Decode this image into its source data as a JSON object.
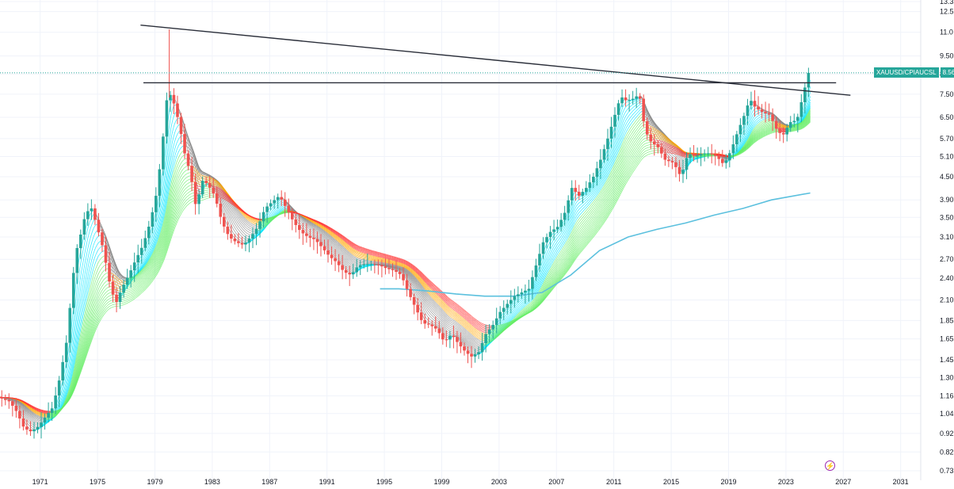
{
  "symbol_label": "XAUUSD/CPIAUCSL",
  "last_value_label": "8.56",
  "alert_icon": "lightning-icon",
  "colors": {
    "up": "#26a69a",
    "down": "#ef5350",
    "long_ma": "#5bc0de",
    "trendline": "#2a2e39",
    "price_line": "#26a69a",
    "ribbon_green": "#66ee66",
    "ribbon_cyan": "#00e5ff",
    "ribbon_red": "#ff3333",
    "ribbon_orange": "#ffa500",
    "ribbon_gray": "#888888"
  },
  "chart_data": {
    "type": "candlestick",
    "title": "",
    "y_scale": "log",
    "ylim": [
      0.73,
      13.3
    ],
    "y_ticks": [
      "13.3",
      "12.5",
      "11.0",
      "9.50",
      "8.50",
      "7.50",
      "6.50",
      "5.70",
      "5.10",
      "4.50",
      "3.90",
      "3.50",
      "3.10",
      "2.70",
      "2.40",
      "2.10",
      "1.85",
      "1.65",
      "1.45",
      "1.30",
      "1.16",
      "1.04",
      "0.92",
      "0.82",
      "0.73"
    ],
    "x_ticks": [
      "1971",
      "1975",
      "1979",
      "1983",
      "1987",
      "1991",
      "1995",
      "1999",
      "2003",
      "2007",
      "2011",
      "2015",
      "2019",
      "2023",
      "2027",
      "2031"
    ],
    "xlim": [
      1968.2,
      2032.4
    ],
    "last_value": 8.56,
    "price_points": [
      [
        1968.2,
        1.15
      ],
      [
        1969.0,
        1.12
      ],
      [
        1969.5,
        1.05
      ],
      [
        1970.0,
        0.95
      ],
      [
        1970.5,
        0.93
      ],
      [
        1971.0,
        0.96
      ],
      [
        1971.5,
        1.02
      ],
      [
        1972.0,
        1.08
      ],
      [
        1972.5,
        1.3
      ],
      [
        1973.0,
        1.65
      ],
      [
        1973.3,
        2.2
      ],
      [
        1973.6,
        2.8
      ],
      [
        1974.0,
        3.2
      ],
      [
        1974.3,
        3.6
      ],
      [
        1974.7,
        3.7
      ],
      [
        1975.0,
        3.4
      ],
      [
        1975.5,
        2.9
      ],
      [
        1976.0,
        2.3
      ],
      [
        1976.4,
        2.05
      ],
      [
        1976.8,
        2.25
      ],
      [
        1977.3,
        2.45
      ],
      [
        1977.8,
        2.7
      ],
      [
        1978.3,
        2.95
      ],
      [
        1978.8,
        3.4
      ],
      [
        1979.2,
        4.0
      ],
      [
        1979.6,
        5.2
      ],
      [
        1979.9,
        7.1
      ],
      [
        1980.1,
        7.6
      ],
      [
        1980.4,
        7.2
      ],
      [
        1980.8,
        6.3
      ],
      [
        1981.2,
        5.2
      ],
      [
        1981.6,
        4.6
      ],
      [
        1982.0,
        3.7
      ],
      [
        1982.4,
        4.4
      ],
      [
        1982.8,
        4.3
      ],
      [
        1983.3,
        4.0
      ],
      [
        1983.8,
        3.4
      ],
      [
        1984.3,
        3.1
      ],
      [
        1984.8,
        3.0
      ],
      [
        1985.3,
        2.95
      ],
      [
        1985.8,
        3.1
      ],
      [
        1986.3,
        3.3
      ],
      [
        1986.8,
        3.7
      ],
      [
        1987.3,
        3.85
      ],
      [
        1987.8,
        4.0
      ],
      [
        1988.3,
        3.7
      ],
      [
        1988.8,
        3.4
      ],
      [
        1989.3,
        3.2
      ],
      [
        1989.8,
        3.1
      ],
      [
        1990.3,
        3.05
      ],
      [
        1990.8,
        2.9
      ],
      [
        1991.3,
        2.75
      ],
      [
        1991.8,
        2.65
      ],
      [
        1992.3,
        2.5
      ],
      [
        1992.8,
        2.45
      ],
      [
        1993.3,
        2.6
      ],
      [
        1993.8,
        2.62
      ],
      [
        1994.3,
        2.62
      ],
      [
        1994.8,
        2.6
      ],
      [
        1995.3,
        2.55
      ],
      [
        1995.8,
        2.52
      ],
      [
        1996.3,
        2.45
      ],
      [
        1996.8,
        2.2
      ],
      [
        1997.3,
        2.0
      ],
      [
        1997.8,
        1.82
      ],
      [
        1998.3,
        1.8
      ],
      [
        1998.8,
        1.75
      ],
      [
        1999.3,
        1.62
      ],
      [
        1999.8,
        1.7
      ],
      [
        2000.3,
        1.6
      ],
      [
        2000.8,
        1.52
      ],
      [
        2001.2,
        1.48
      ],
      [
        2001.7,
        1.52
      ],
      [
        2002.2,
        1.7
      ],
      [
        2002.7,
        1.8
      ],
      [
        2003.2,
        1.95
      ],
      [
        2003.7,
        2.05
      ],
      [
        2004.2,
        2.15
      ],
      [
        2004.7,
        2.2
      ],
      [
        2005.2,
        2.25
      ],
      [
        2005.7,
        2.6
      ],
      [
        2006.2,
        3.0
      ],
      [
        2006.7,
        3.2
      ],
      [
        2007.2,
        3.3
      ],
      [
        2007.7,
        3.6
      ],
      [
        2008.2,
        4.2
      ],
      [
        2008.7,
        4.0
      ],
      [
        2009.2,
        4.2
      ],
      [
        2009.7,
        4.5
      ],
      [
        2010.2,
        5.0
      ],
      [
        2010.7,
        5.7
      ],
      [
        2011.2,
        6.6
      ],
      [
        2011.6,
        7.4
      ],
      [
        2012.0,
        7.2
      ],
      [
        2012.5,
        7.3
      ],
      [
        2012.9,
        7.5
      ],
      [
        2013.3,
        6.0
      ],
      [
        2013.7,
        5.6
      ],
      [
        2014.2,
        5.4
      ],
      [
        2014.7,
        5.0
      ],
      [
        2015.3,
        4.9
      ],
      [
        2015.8,
        4.5
      ],
      [
        2016.3,
        5.2
      ],
      [
        2016.8,
        5.1
      ],
      [
        2017.3,
        5.2
      ],
      [
        2017.8,
        5.2
      ],
      [
        2018.3,
        5.1
      ],
      [
        2018.8,
        4.85
      ],
      [
        2019.3,
        5.3
      ],
      [
        2019.8,
        6.0
      ],
      [
        2020.3,
        6.7
      ],
      [
        2020.6,
        7.3
      ],
      [
        2021.0,
        6.9
      ],
      [
        2021.5,
        6.7
      ],
      [
        2022.0,
        6.6
      ],
      [
        2022.5,
        6.0
      ],
      [
        2022.9,
        5.8
      ],
      [
        2023.4,
        6.3
      ],
      [
        2023.9,
        6.4
      ],
      [
        2024.3,
        7.4
      ],
      [
        2024.7,
        8.56
      ]
    ],
    "spikes": [
      [
        1980.0,
        11.2
      ]
    ],
    "long_ma": [
      [
        1994.7,
        2.25
      ],
      [
        1996,
        2.25
      ],
      [
        1998,
        2.22
      ],
      [
        2000,
        2.18
      ],
      [
        2002,
        2.15
      ],
      [
        2004,
        2.15
      ],
      [
        2006,
        2.2
      ],
      [
        2008,
        2.45
      ],
      [
        2010,
        2.85
      ],
      [
        2012,
        3.1
      ],
      [
        2014,
        3.25
      ],
      [
        2016,
        3.38
      ],
      [
        2018,
        3.55
      ],
      [
        2020,
        3.7
      ],
      [
        2022,
        3.9
      ],
      [
        2024.7,
        4.07
      ]
    ],
    "trendlines": [
      {
        "x": [
          1978.0,
          2027.5
        ],
        "y": [
          11.5,
          7.45
        ]
      },
      {
        "x": [
          1978.2,
          2026.5
        ],
        "y": [
          8.05,
          8.05
        ]
      }
    ]
  }
}
